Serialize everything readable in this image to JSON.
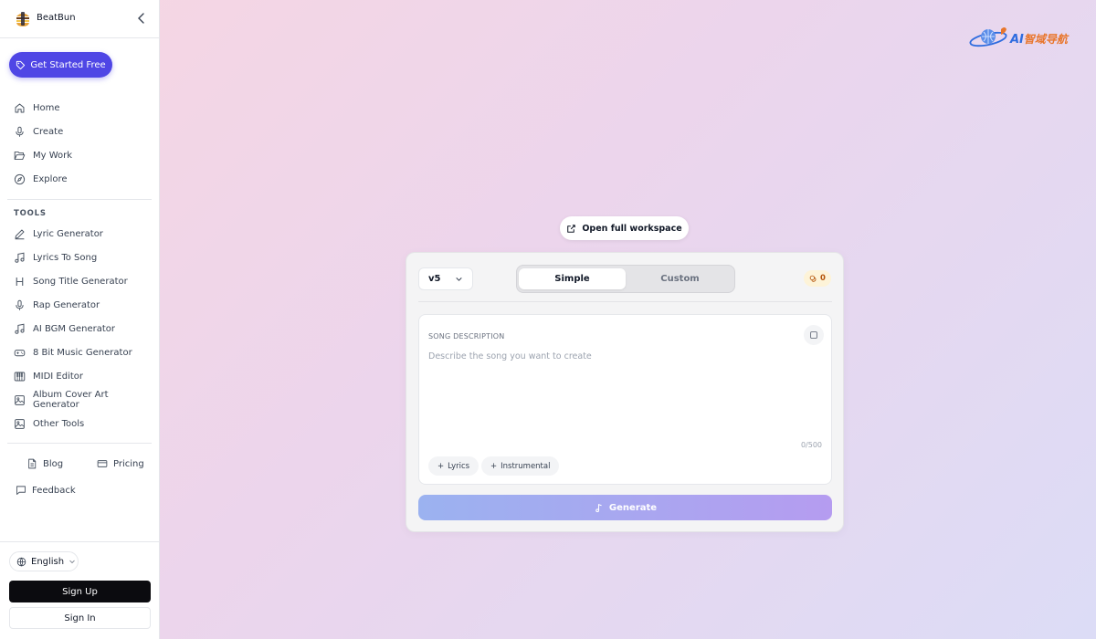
{
  "brand": {
    "name": "BeatBun"
  },
  "sidebar": {
    "cta_label": "Get Started Free",
    "main_nav": [
      {
        "label": "Home",
        "icon": "home-icon"
      },
      {
        "label": "Create",
        "icon": "microphone-icon"
      },
      {
        "label": "My Work",
        "icon": "folder-open-icon"
      },
      {
        "label": "Explore",
        "icon": "compass-icon"
      }
    ],
    "tools_title": "TOOLS",
    "tools": [
      {
        "label": "Lyric Generator",
        "icon": "pen-icon"
      },
      {
        "label": "Lyrics To Song",
        "icon": "music-note-icon"
      },
      {
        "label": "Song Title Generator",
        "icon": "heading-icon"
      },
      {
        "label": "Rap Generator",
        "icon": "microphone-icon"
      },
      {
        "label": "AI BGM Generator",
        "icon": "music-note-icon"
      },
      {
        "label": "8 Bit Music Generator",
        "icon": "gamepad-icon"
      },
      {
        "label": "MIDI Editor",
        "icon": "piano-icon"
      },
      {
        "label": "Album Cover Art Generator",
        "icon": "image-icon"
      },
      {
        "label": "Other Tools",
        "icon": "image-icon"
      }
    ],
    "blog_label": "Blog",
    "pricing_label": "Pricing",
    "feedback_label": "Feedback",
    "language": "English",
    "signup_label": "Sign Up",
    "signin_label": "Sign In"
  },
  "watermark": {
    "text_latin": "AI",
    "text_cn": "智域导航"
  },
  "workspace": {
    "open_full_label": "Open full workspace",
    "version": "v5",
    "modes": [
      "Simple",
      "Custom"
    ],
    "active_mode": "Simple",
    "credits": "0",
    "description": {
      "label": "SONG DESCRIPTION",
      "placeholder": "Describe the song you want to create",
      "value": "",
      "char_count": "0/500"
    },
    "chips": [
      "Lyrics",
      "Instrumental"
    ],
    "generate_label": "Generate"
  },
  "colors": {
    "accent": "#4f46e5",
    "credits_text": "#b45309",
    "generate_from": "#9bb2f0",
    "generate_to": "#b59cf0"
  }
}
